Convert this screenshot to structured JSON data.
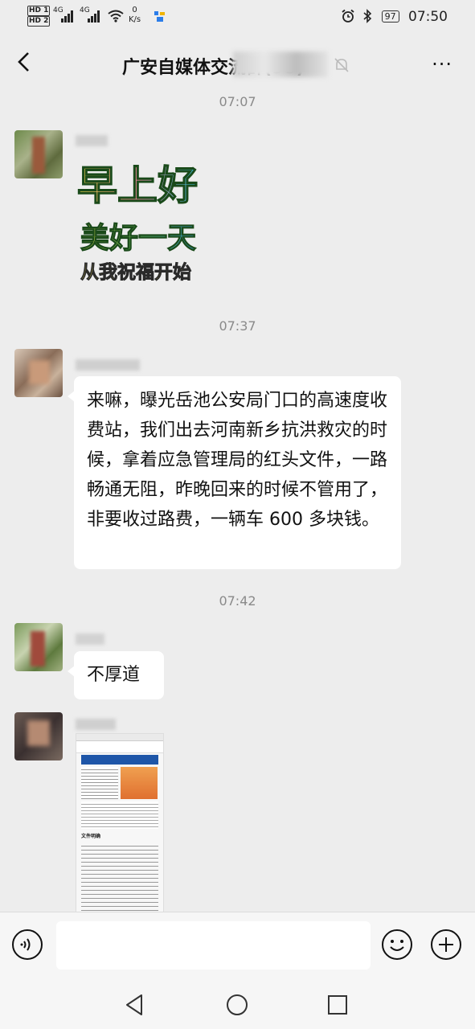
{
  "status_bar": {
    "hd1": "HD 1",
    "hd2": "HD 2",
    "net1": "4G",
    "net2": "4G",
    "speed_value": "0",
    "speed_unit": "K/s",
    "battery": "97",
    "clock": "07:50"
  },
  "header": {
    "title": "广安自媒体交流群(95)",
    "more_label": "···"
  },
  "messages": {
    "time1": "07:07",
    "sticker_line1": "早上好",
    "sticker_line2": "美好一天",
    "sticker_line3": "从我祝福开始",
    "time2": "07:37",
    "msg2_text": "来嘛，曝光岳池公安局门口的高速度收费站，我们出去河南新乡抗洪救灾的时候，拿着应急管理局的红头文件，一路畅通无阻，昨晚回来的时候不管用了，非要收过路费，一辆车 600 多块钱。",
    "time3": "07:42",
    "msg3_text": "不厚道",
    "shot_heading": "文件明确"
  },
  "input": {
    "placeholder": ""
  },
  "colors": {
    "background": "#ededed",
    "bubble": "#ffffff",
    "sticker_yellow": "#f2e34a",
    "sticker_blue": "#3da1f2",
    "sticker_green": "#6bd16b"
  }
}
